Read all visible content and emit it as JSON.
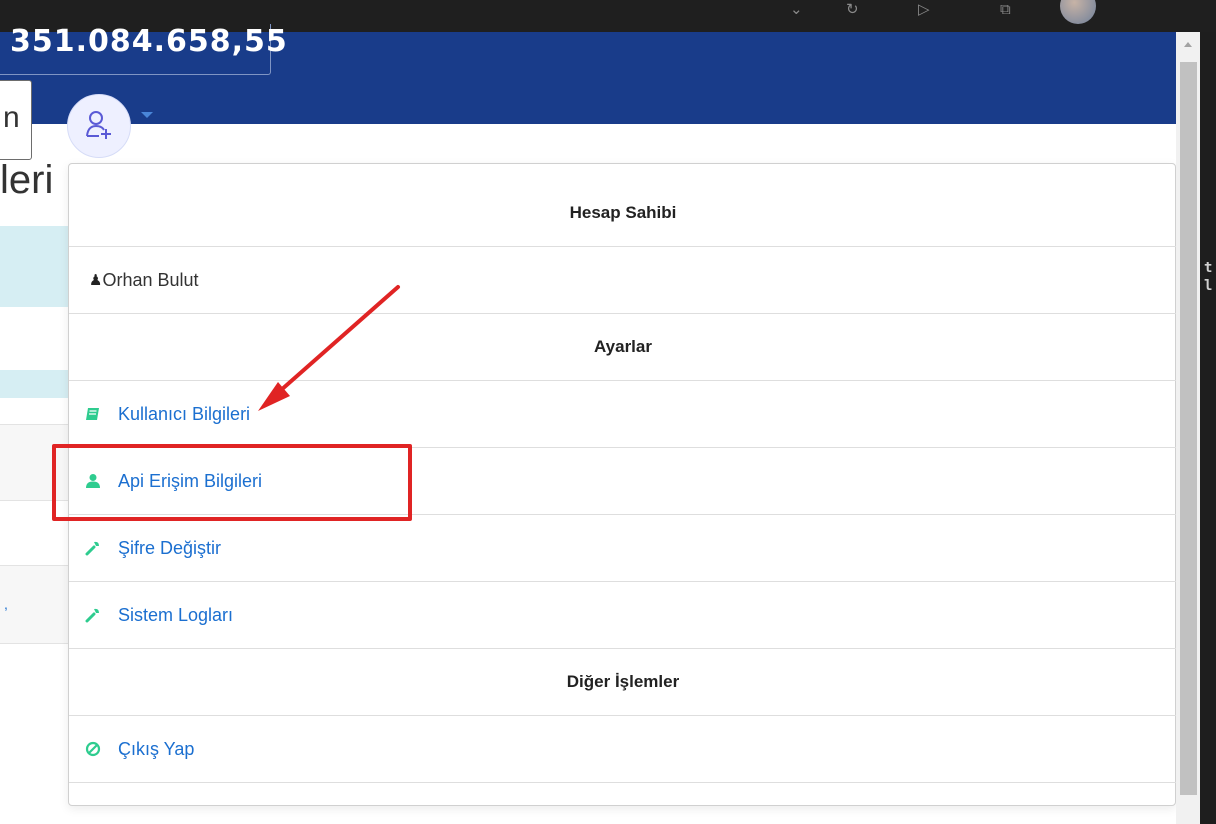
{
  "balance": "351.084.658,55",
  "search_partial": "n",
  "page_heading_partial": "leri",
  "user_avatar_icon": "user-plus-icon",
  "dropdown": {
    "sections": [
      {
        "header": "Hesap Sahibi"
      },
      {
        "user_name": "Orhan Bulut"
      },
      {
        "header": "Ayarlar"
      },
      {
        "item": "Kullanıcı Bilgileri",
        "icon": "book-icon"
      },
      {
        "item": "Api Erişim Bilgileri",
        "icon": "user-icon"
      },
      {
        "item": "Şifre Değiştir",
        "icon": "wrench-icon"
      },
      {
        "item": "Sistem Logları",
        "icon": "wrench-icon"
      },
      {
        "header": "Diğer İşlemler"
      },
      {
        "item": "Çıkış Yap",
        "icon": "ban-icon"
      }
    ]
  },
  "colors": {
    "header_bg": "#193c8a",
    "link": "#1b6fd0",
    "icon_green": "#2ecc8f",
    "annotation_red": "#e02424"
  }
}
